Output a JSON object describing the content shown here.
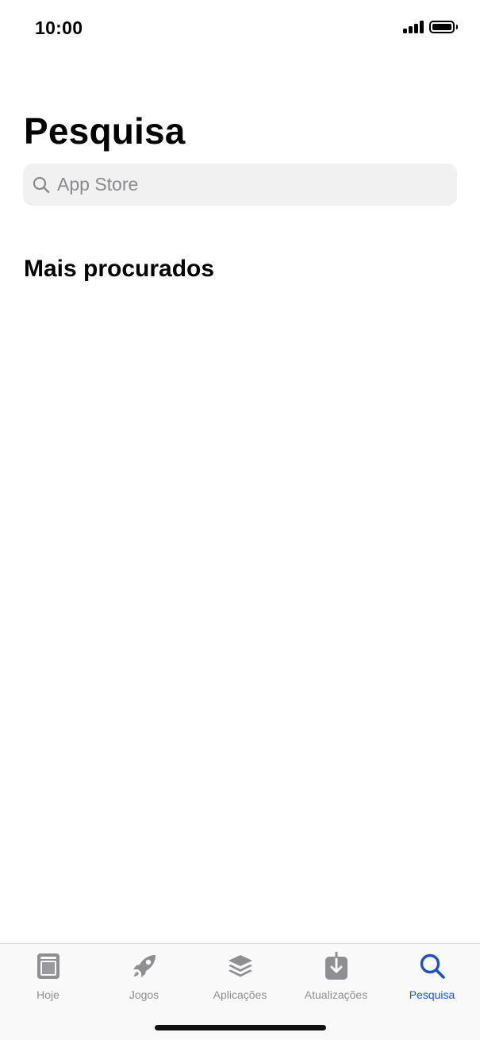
{
  "status_bar": {
    "time": "10:00"
  },
  "page": {
    "title": "Pesquisa"
  },
  "search": {
    "placeholder": "App Store",
    "value": ""
  },
  "sections": {
    "trending_title": "Mais procurados"
  },
  "tab_bar": {
    "tabs": [
      {
        "label": "Hoje",
        "icon": "today-icon",
        "active": false
      },
      {
        "label": "Jogos",
        "icon": "rocket-icon",
        "active": false
      },
      {
        "label": "Aplicações",
        "icon": "apps-stack-icon",
        "active": false
      },
      {
        "label": "Atualizações",
        "icon": "download-icon",
        "active": false
      },
      {
        "label": "Pesquisa",
        "icon": "search-icon",
        "active": true
      }
    ]
  },
  "colors": {
    "accent": "#1a52c8",
    "inactive": "#8e8e93",
    "search_bg": "#f1f1f2"
  }
}
